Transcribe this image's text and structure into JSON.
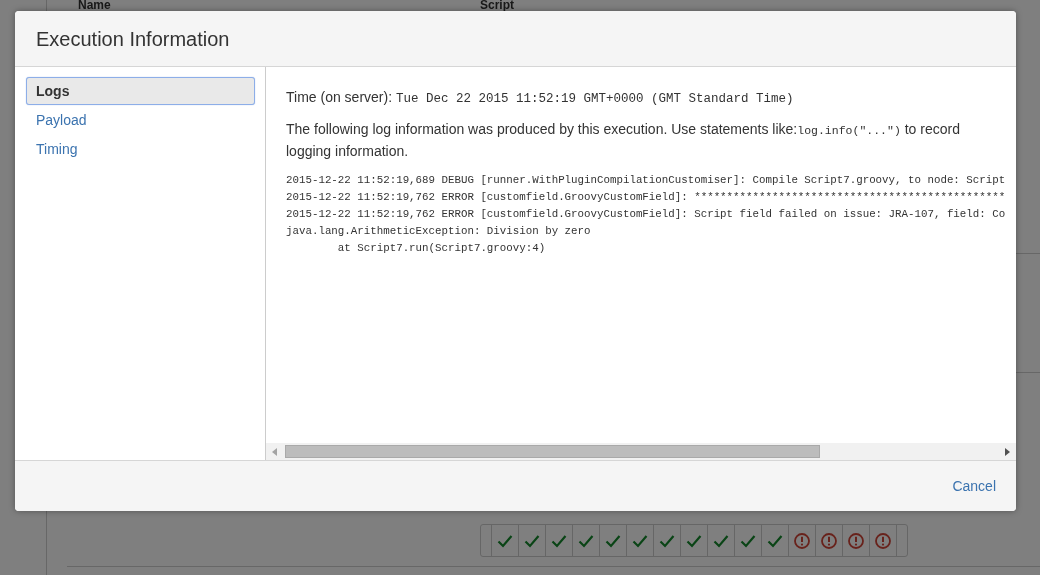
{
  "background": {
    "columns": [
      "Name",
      "Script"
    ],
    "results": [
      {
        "kind": "success"
      },
      {
        "kind": "success"
      },
      {
        "kind": "success"
      },
      {
        "kind": "success"
      },
      {
        "kind": "success"
      },
      {
        "kind": "success"
      },
      {
        "kind": "success"
      },
      {
        "kind": "success"
      },
      {
        "kind": "success"
      },
      {
        "kind": "success"
      },
      {
        "kind": "success"
      },
      {
        "kind": "error"
      },
      {
        "kind": "error"
      },
      {
        "kind": "error"
      },
      {
        "kind": "error"
      }
    ]
  },
  "dialog": {
    "title": "Execution Information",
    "nav": [
      {
        "label": "Logs",
        "selected": true
      },
      {
        "label": "Payload",
        "selected": false
      },
      {
        "label": "Timing",
        "selected": false
      }
    ],
    "logs": {
      "time_label": "Time (on server):",
      "time_value": "Tue Dec 22 2015 11:52:19 GMT+0000 (GMT Standard Time)",
      "intro": {
        "before": "The following log information was produced by this execution. Use statements like:",
        "code": "log.info(\"...\")",
        "after": " to record logging information."
      },
      "lines": [
        "2015-12-22 11:52:19,689 DEBUG [runner.WithPluginCompilationCustomiser]: Compile Script7.groovy, to node: Script",
        "2015-12-22 11:52:19,762 ERROR [customfield.GroovyCustomField]: ************************************************",
        "2015-12-22 11:52:19,762 ERROR [customfield.GroovyCustomField]: Script field failed on issue: JRA-107, field: Co",
        "java.lang.ArithmeticException: Division by zero",
        "        at Script7.run(Script7.groovy:4)"
      ]
    },
    "buttons": [
      {
        "label": "Cancel"
      }
    ]
  }
}
